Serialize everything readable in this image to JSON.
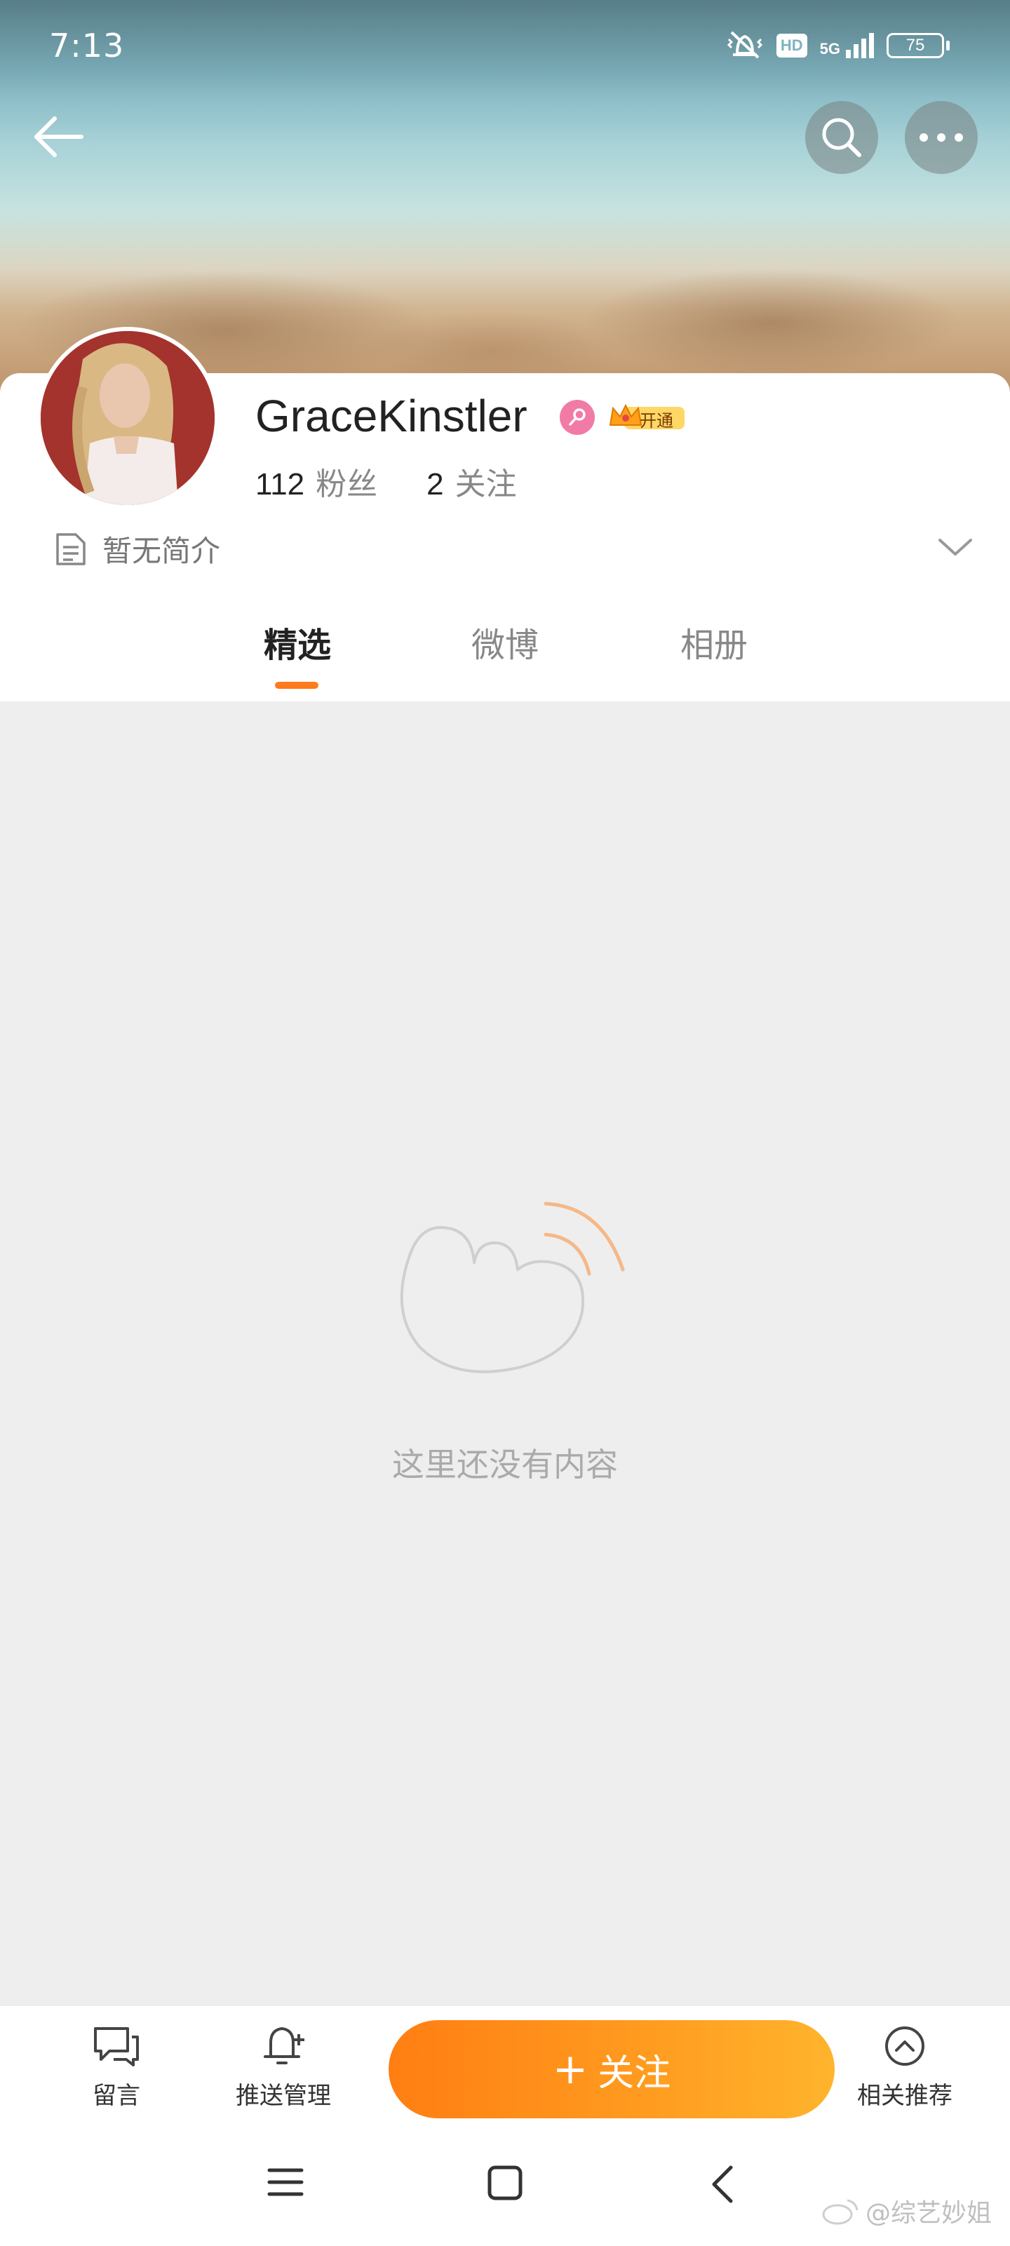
{
  "status_bar": {
    "time": "7:13",
    "icons": [
      "mute-vibrate-icon",
      "hd-icon",
      "5g-signal-icon",
      "battery-icon"
    ],
    "hd_label": "HD",
    "network_label": "5G",
    "battery_level": "75"
  },
  "header": {
    "back_icon": "arrow-left-icon",
    "search_icon": "search-icon",
    "more_icon": "more-icon"
  },
  "profile": {
    "name": "GraceKinstler",
    "vip_label": "开通",
    "followers_count": "112",
    "followers_label": "粉丝",
    "following_count": "2",
    "following_label": "关注",
    "intro": "暂无简介"
  },
  "tabs": [
    {
      "label": "精选",
      "active": true
    },
    {
      "label": "微博",
      "active": false
    },
    {
      "label": "相册",
      "active": false
    }
  ],
  "empty_state": {
    "message": "这里还没有内容"
  },
  "bottom_bar": {
    "message_label": "留言",
    "push_label": "推送管理",
    "follow_label": "关注",
    "related_label": "相关推荐"
  },
  "watermark": "@综艺妙姐",
  "colors": {
    "accent": "#ff7a1a",
    "follow_start": "#ff7e12",
    "follow_end": "#ffb42d",
    "background": "#eeeeee"
  }
}
